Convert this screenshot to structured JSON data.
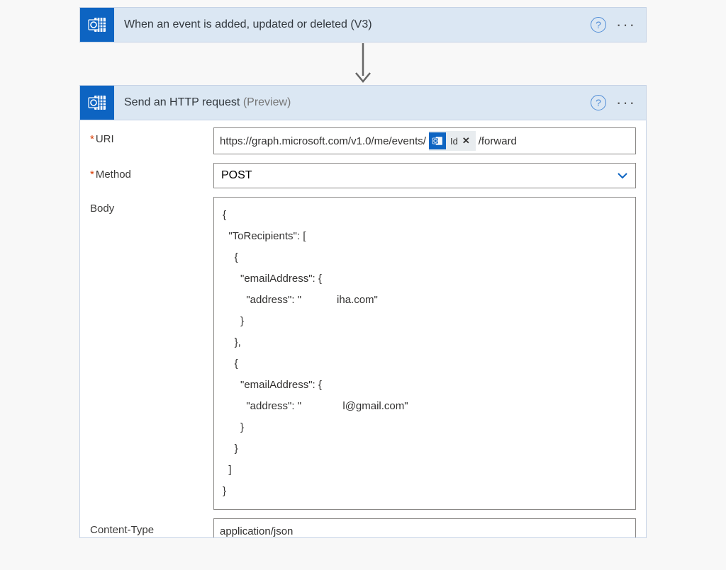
{
  "trigger": {
    "title": "When an event is added, updated or deleted (V3)"
  },
  "action": {
    "title": "Send an HTTP request",
    "preview": "(Preview)"
  },
  "fields": {
    "uri": {
      "label": "URI",
      "prefix": "https://graph.microsoft.com/v1.0/me/events/",
      "token_label": "Id",
      "suffix": "/forward"
    },
    "method": {
      "label": "Method",
      "value": "POST"
    },
    "body": {
      "label": "Body",
      "lines": {
        "l0": "{",
        "l1": "  \"ToRecipients\": [",
        "l2": "    {",
        "l3": "      \"emailAddress\": {",
        "l4": "        \"address\": \"            iha.com\"",
        "l5": "      }",
        "l6": "    },",
        "l7": "    {",
        "l8": "      \"emailAddress\": {",
        "l9": "        \"address\": \"              l@gmail.com\"",
        "l10": "      }",
        "l11": "    }",
        "l12": "  ]",
        "l13": "}"
      }
    },
    "contentType": {
      "label": "Content-Type",
      "value": "application/json"
    }
  }
}
